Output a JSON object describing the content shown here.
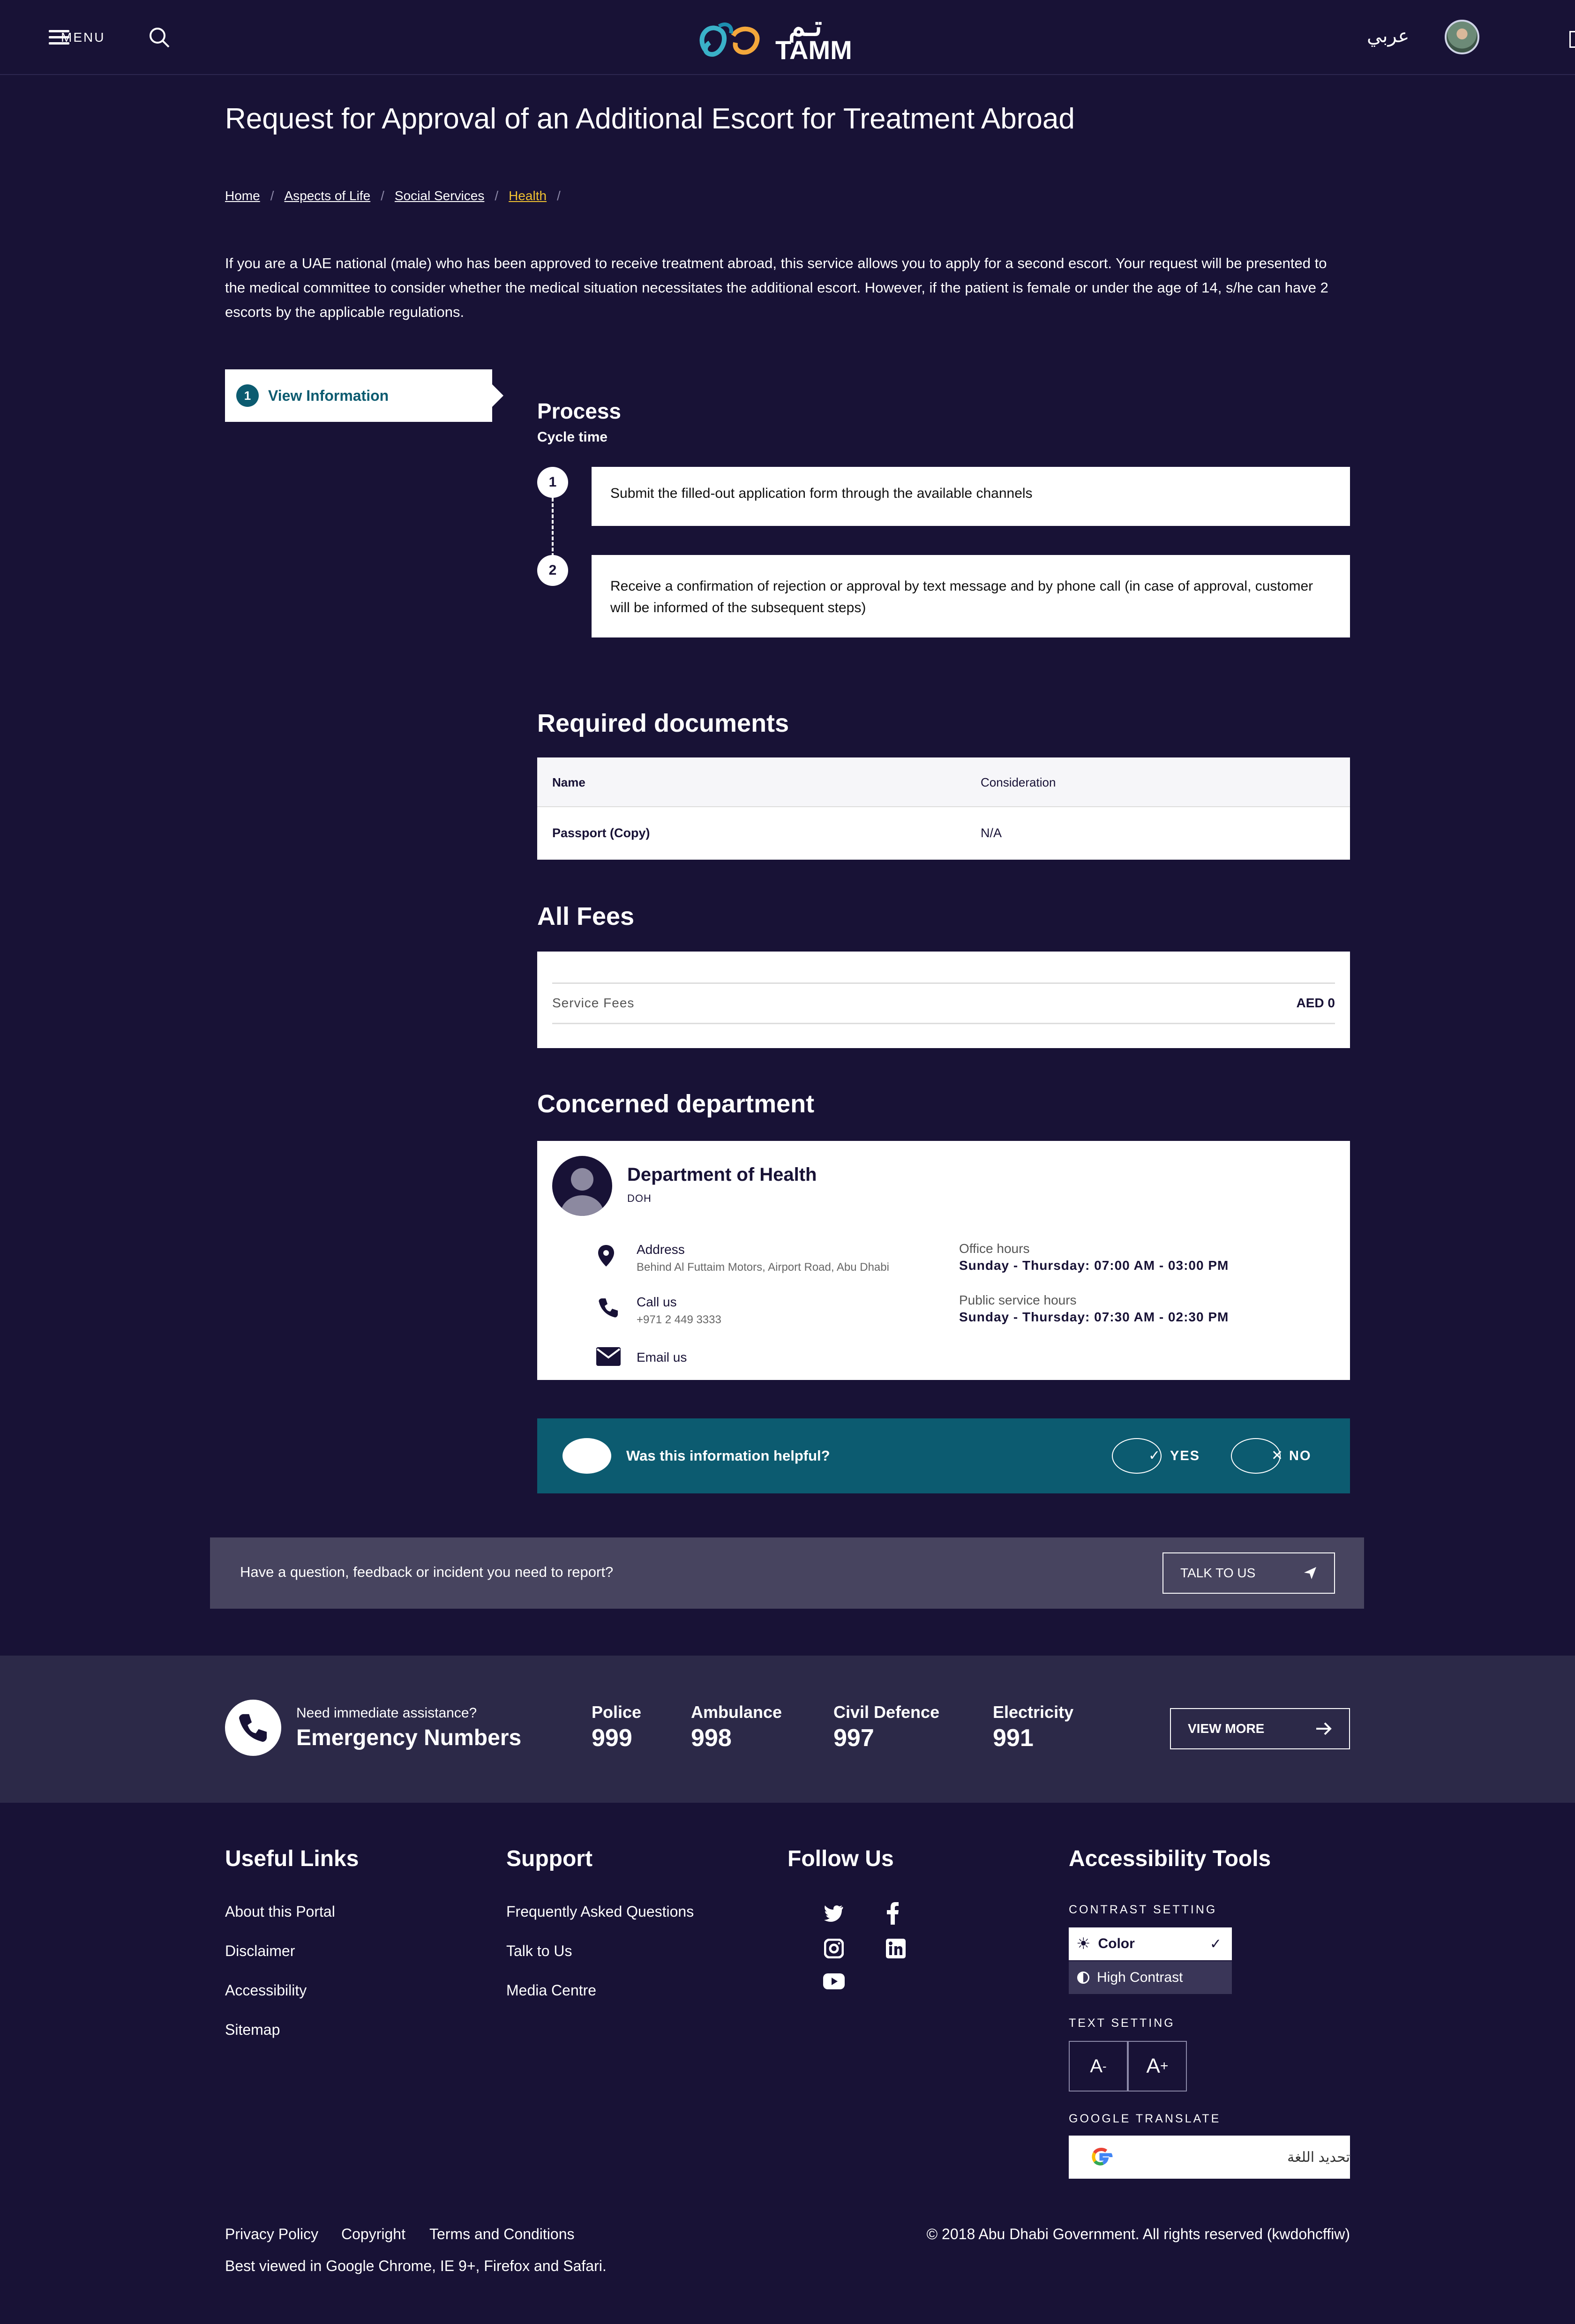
{
  "header": {
    "menu_label": "MENU",
    "logo_text": "TAMM",
    "logo_arabic": "تـم",
    "lang_toggle": "عربي"
  },
  "page": {
    "title": "Request for Approval of an Additional Escort for Treatment Abroad",
    "breadcrumb": [
      "Home",
      "Aspects of Life",
      "Social Services",
      "Health"
    ],
    "description": "If you are a UAE national (male) who has been approved to receive treatment abroad, this service allows you to apply for a second escort. Your request will be presented to the medical committee to consider whether the medical situation necessitates the additional escort. However, if the patient is female or under the age of 14, s/he can have 2 escorts by the applicable regulations."
  },
  "sidenav": {
    "step_number": "1",
    "label": "View Information"
  },
  "process": {
    "title": "Process",
    "subtitle": "Cycle time",
    "steps": [
      {
        "num": "1",
        "text": "Submit the filled-out application form through the available channels"
      },
      {
        "num": "2",
        "text": "Receive a confirmation of rejection or approval by text message and by phone call (in case of approval, customer will be informed of the subsequent steps)"
      }
    ]
  },
  "documents": {
    "title": "Required documents",
    "headers": [
      "Name",
      "Consideration"
    ],
    "rows": [
      [
        "Passport (Copy)",
        "N/A"
      ]
    ]
  },
  "fees": {
    "title": "All Fees",
    "label": "Service Fees",
    "value": "AED 0"
  },
  "department": {
    "title": "Concerned department",
    "name": "Department of Health",
    "abbr": "DOH",
    "address_label": "Address",
    "address_value": "Behind Al Futtaim Motors, Airport Road, Abu Dhabi",
    "call_label": "Call us",
    "call_value": "+971 2 449 3333",
    "email_label": "Email us",
    "office_label": "Office hours",
    "office_value": "Sunday - Thursday: 07:00 AM - 03:00 PM",
    "public_label": "Public service hours",
    "public_value": "Sunday - Thursday: 07:30 AM - 02:30 PM"
  },
  "feedback": {
    "question": "Was this information helpful?",
    "yes": "YES",
    "no": "NO"
  },
  "report": {
    "text": "Have a question, feedback or incident you need to report?",
    "button": "TALK TO US"
  },
  "emergency": {
    "small": "Need immediate assistance?",
    "title": "Emergency Numbers",
    "items": [
      {
        "label": "Police",
        "num": "999"
      },
      {
        "label": "Ambulance",
        "num": "998"
      },
      {
        "label": "Civil Defence",
        "num": "997"
      },
      {
        "label": "Electricity",
        "num": "991"
      }
    ],
    "button": "VIEW MORE"
  },
  "footer": {
    "useful_title": "Useful Links",
    "useful": [
      "About this Portal",
      "Disclaimer",
      "Accessibility",
      "Sitemap"
    ],
    "support_title": "Support",
    "support": [
      "Frequently Asked Questions",
      "Talk to Us",
      "Media Centre"
    ],
    "follow_title": "Follow Us",
    "access_title": "Accessibility Tools",
    "contrast_label": "CONTRAST SETTING",
    "contrast_color": "Color",
    "contrast_high": "High Contrast",
    "text_label": "TEXT SETTING",
    "text_minus": "A",
    "text_plus": "A",
    "translate_label": "GOOGLE TRANSLATE",
    "translate_value": "تحديد اللغة",
    "bottom_links": [
      "Privacy Policy",
      "Copyright",
      "Terms and Conditions"
    ],
    "copyright": "© 2018 Abu Dhabi Government. All rights reserved (kwdohcffiw)",
    "best_viewed": "Best viewed in Google Chrome, IE 9+, Firefox and Safari."
  },
  "colors": {
    "background": "#181236",
    "accent_teal": "#0c5b70",
    "breadcrumb_current": "#f1c231",
    "report_bar": "#47445f",
    "emergency_band": "#2c2948"
  }
}
